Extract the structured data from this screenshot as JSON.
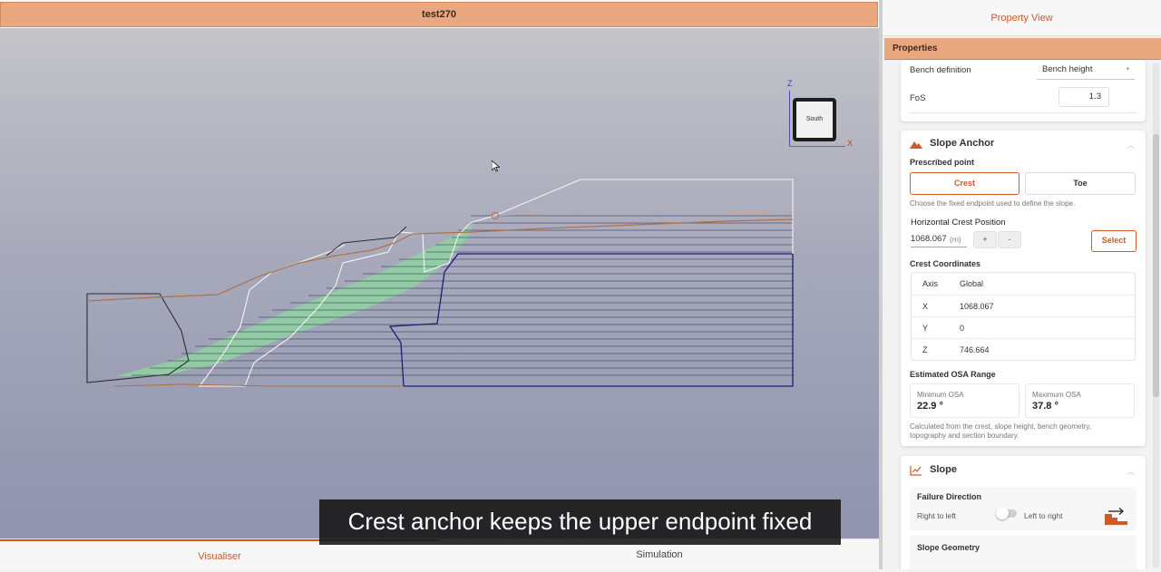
{
  "visualiser": {
    "title": "test270",
    "viewcube": {
      "face_label": "South",
      "z_label": "Z",
      "x_label": "X"
    },
    "tabs": [
      {
        "label": "Visualiser"
      },
      {
        "label": "Simulation"
      }
    ],
    "caption": "Crest anchor keeps the upper endpoint fixed"
  },
  "property_view": {
    "title": "Property View",
    "properties_label": "Properties",
    "bench_definition": {
      "label": "Bench definition",
      "value": "Bench height"
    },
    "fos": {
      "label": "FoS",
      "value": "1.3"
    },
    "slope_anchor": {
      "title": "Slope Anchor",
      "prescribed_point_label": "Prescribed point",
      "options": [
        "Crest",
        "Toe"
      ],
      "selected": "Crest",
      "hint": "Choose the fixed endpoint used to define the slope.",
      "horizontal_crest": {
        "label": "Horizontal Crest Position",
        "value": "1068.067",
        "unit": "(m)",
        "plus": "+",
        "minus": "-",
        "select_label": "Select"
      },
      "coordinates": {
        "label": "Crest Coordinates",
        "header": {
          "axis": "Axis",
          "frame": "Global"
        },
        "rows": [
          {
            "axis": "X",
            "value": "1068.067"
          },
          {
            "axis": "Y",
            "value": "0"
          },
          {
            "axis": "Z",
            "value": "746.664"
          }
        ]
      },
      "osa": {
        "label": "Estimated OSA Range",
        "min_label": "Minimum OSA",
        "min_value": "22.9 °",
        "max_label": "Maximum OSA",
        "max_value": "37.8 °",
        "hint": "Calculated from the crest, slope height, bench geometry, topography and section boundary."
      }
    },
    "slope": {
      "title": "Slope",
      "failure_direction_label": "Failure Direction",
      "left_option": "Right to left",
      "right_option": "Left to right",
      "slope_geometry_label": "Slope Geometry"
    }
  },
  "colors": {
    "accent": "#d0582a",
    "header_bar": "#e9a880",
    "slip_band": "#8fd1a0",
    "section_boundary": "#1a1f7a",
    "topography": "#b07045"
  }
}
